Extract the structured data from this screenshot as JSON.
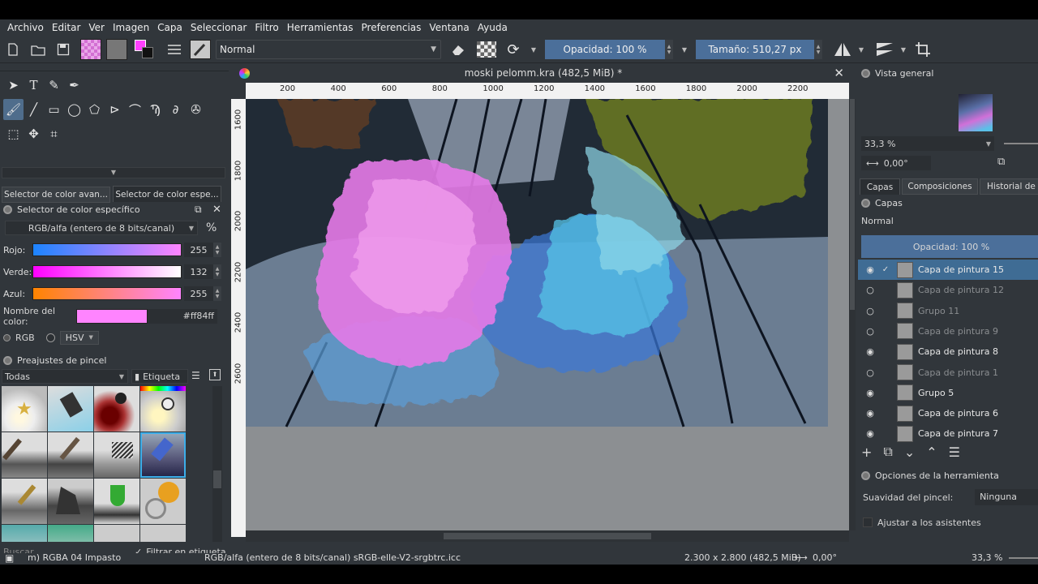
{
  "menu": [
    "Archivo",
    "Editar",
    "Ver",
    "Imagen",
    "Capa",
    "Seleccionar",
    "Filtro",
    "Herramientas",
    "Preferencias",
    "Ventana",
    "Ayuda"
  ],
  "toolbar": {
    "blend_mode": "Normal",
    "opacity": "Opacidad: 100 %",
    "size": "Tamaño: 510,27 px"
  },
  "left": {
    "tab1": "Selector de color avan...",
    "tab2": "Selector de color espe...",
    "panel_title": "Selector de color específico",
    "color_model": "RGB/alfa (entero de 8 bits/canal)",
    "percent": "%",
    "channels": [
      {
        "label": "Rojo:",
        "value": "255"
      },
      {
        "label": "Verde:",
        "value": "132"
      },
      {
        "label": "Azul:",
        "value": "255"
      }
    ],
    "color_name_label": "Nombre del color:",
    "color_hex": "#ff84ff",
    "color_swatch": "#ff84ff",
    "mode_rgb": "RGB",
    "mode_hsv": "HSV",
    "presets_title": "Preajustes de pincel",
    "presets_filter": "Todas",
    "tag_label": "Etiqueta",
    "search_placeholder": "Buscar",
    "filter_tag": "Filtrar en etiqueta"
  },
  "document": {
    "title": "moski pelomm.kra (482,5 MiB) *",
    "ruler_h": [
      "200",
      "400",
      "600",
      "800",
      "1000",
      "1200",
      "1400",
      "1600",
      "1800",
      "2000",
      "2200"
    ],
    "ruler_v": [
      "1600",
      "1800",
      "2000",
      "2200",
      "2400",
      "2600"
    ]
  },
  "right": {
    "overview_title": "Vista general",
    "zoom": "33,3 %",
    "rotation": "0,00°",
    "tabs": [
      "Capas",
      "Composiciones",
      "Historial de d"
    ],
    "layers_title": "Capas",
    "blend_mode": "Normal",
    "opacity": "Opacidad:  100 %",
    "layers": [
      {
        "name": "Capa de pintura 15",
        "visible": true,
        "selected": true
      },
      {
        "name": "Capa de pintura 12",
        "visible": false
      },
      {
        "name": "Grupo 11",
        "visible": false
      },
      {
        "name": "Capa de pintura 9",
        "visible": false
      },
      {
        "name": "Capa de pintura 8",
        "visible": true
      },
      {
        "name": "Capa de pintura 1",
        "visible": false
      },
      {
        "name": "Grupo 5",
        "visible": true
      },
      {
        "name": "Capa de pintura 6",
        "visible": true
      },
      {
        "name": "Capa de pintura 7",
        "visible": true
      }
    ],
    "tool_options_title": "Opciones de la herramienta",
    "smoothing_label": "Suavidad del pincel:",
    "smoothing_value": "Ninguna",
    "snap_label": "Ajustar a los asistentes"
  },
  "status": {
    "brush": "m) RGBA 04 Impasto",
    "colorspace": "RGB/alfa (entero de 8 bits/canal)  sRGB-elle-V2-srgbtrc.icc",
    "dimensions": "2.300 x 2.800 (482,5 MiB)",
    "rotation": "0,00°",
    "zoom": "33,3 %"
  }
}
